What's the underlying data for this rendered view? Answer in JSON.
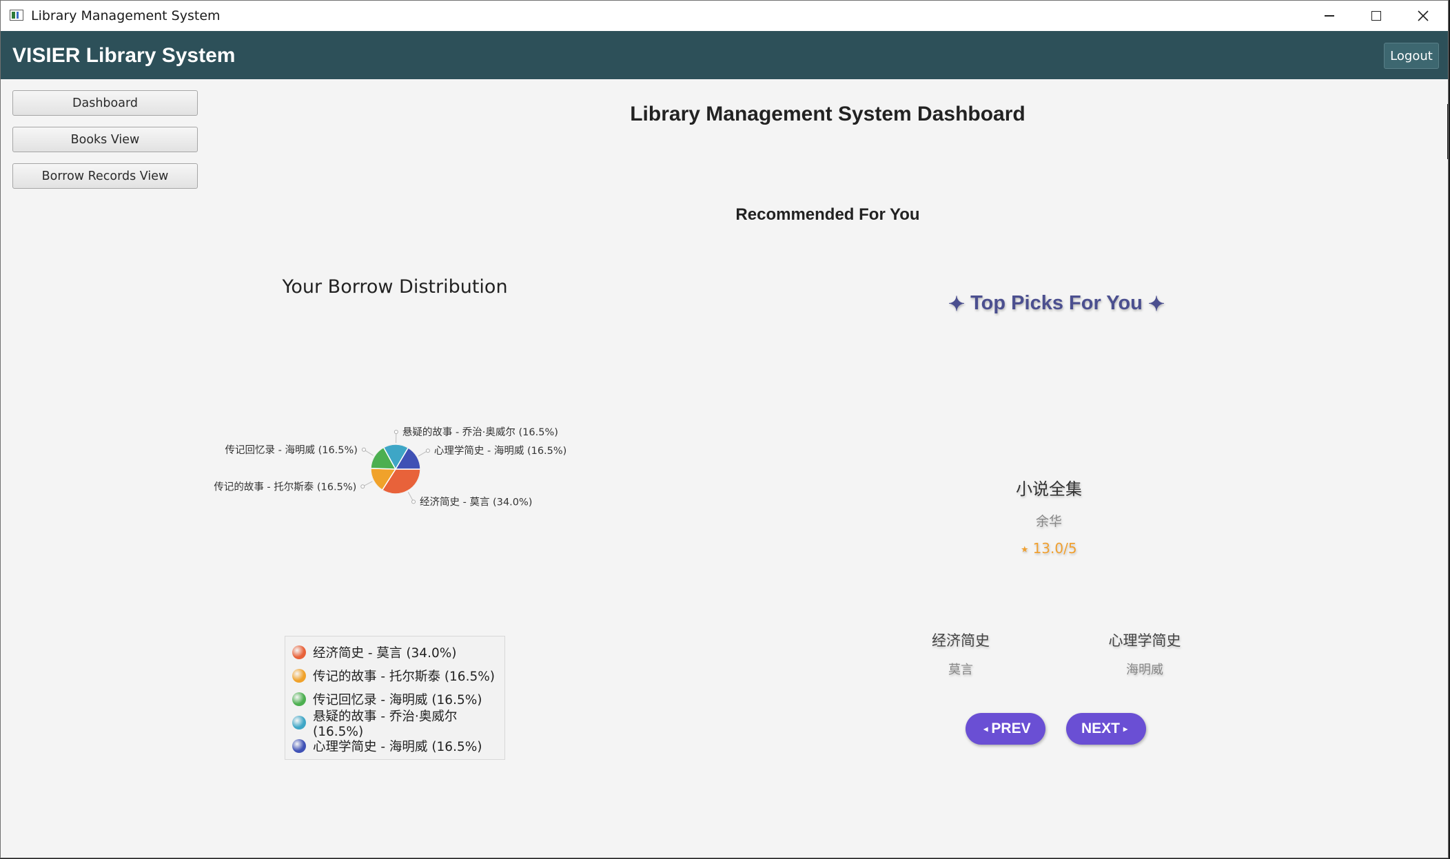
{
  "window": {
    "title": "Library Management System"
  },
  "header": {
    "app_title": "VISIER Library System",
    "logout_label": "Logout"
  },
  "sidebar": {
    "items": [
      {
        "label": "Dashboard"
      },
      {
        "label": "Books View"
      },
      {
        "label": "Borrow Records View"
      }
    ]
  },
  "main": {
    "page_title": "Library Management System Dashboard",
    "recommended_title": "Recommended For You"
  },
  "chart_data": {
    "type": "pie",
    "title": "Your Borrow Distribution",
    "legend_position": "bottom",
    "slices": [
      {
        "label": "经济简史 - 莫言 (34.0%)",
        "value": 34.0,
        "color": "#e8623a"
      },
      {
        "label": "传记的故事 - 托尔斯泰 (16.5%)",
        "value": 16.5,
        "color": "#f0a22b"
      },
      {
        "label": "传记回忆录 - 海明威 (16.5%)",
        "value": 16.5,
        "color": "#4caf50"
      },
      {
        "label": "悬疑的故事 - 乔治·奥威尔 (16.5%)",
        "value": 16.5,
        "color": "#3ea6c6"
      },
      {
        "label": "心理学简史 - 海明威 (16.5%)",
        "value": 16.5,
        "color": "#3f51b5"
      }
    ]
  },
  "recommendations": {
    "title": "Top Picks For You",
    "sparkle_icon": "✦",
    "featured": {
      "title": "小说全集",
      "author": "余华",
      "rating": "⭑ 13.0/5"
    },
    "others": [
      {
        "title": "经济简史",
        "author": "莫言"
      },
      {
        "title": "心理学简史",
        "author": "海明威"
      }
    ],
    "prev_label": "PREV",
    "next_label": "NEXT",
    "prev_icon": "◂",
    "next_icon": "▸",
    "accent_color": "#6a4fd4"
  }
}
